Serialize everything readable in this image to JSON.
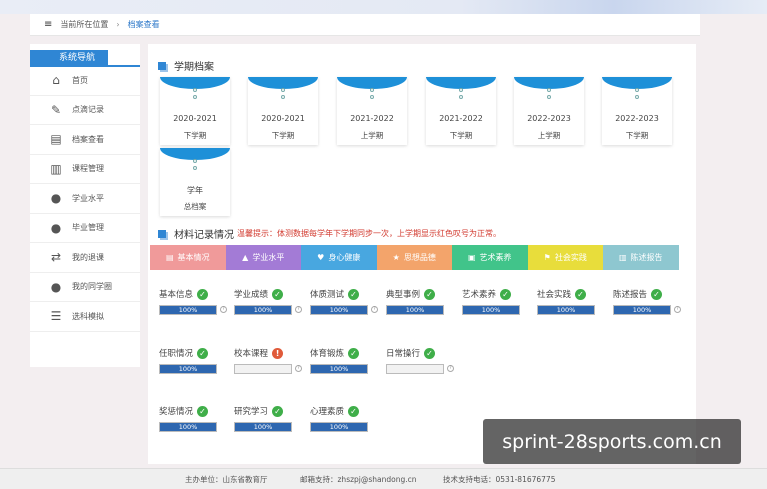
{
  "breadcrumb": {
    "prefix": "当前所在位置",
    "separator": "›",
    "current": "档案查看"
  },
  "sidebar": {
    "title": "系统导航",
    "items": [
      {
        "label": "首页",
        "icon": "home-icon"
      },
      {
        "label": "点滴记录",
        "icon": "edit-icon"
      },
      {
        "label": "档案查看",
        "icon": "archive-icon"
      },
      {
        "label": "课程管理",
        "icon": "book-icon"
      },
      {
        "label": "学业水平",
        "icon": "user-icon"
      },
      {
        "label": "毕业管理",
        "icon": "user-icon"
      },
      {
        "label": "我的退课",
        "icon": "transfer-icon"
      },
      {
        "label": "我的同学圈",
        "icon": "group-icon"
      },
      {
        "label": "选科模拟",
        "icon": "checklist-icon"
      }
    ]
  },
  "term_archive": {
    "title": "学期档案",
    "folders": [
      {
        "year": "2020-2021",
        "term": "下学期"
      },
      {
        "year": "2020-2021",
        "term": "下学期"
      },
      {
        "year": "2021-2022",
        "term": "上学期"
      },
      {
        "year": "2021-2022",
        "term": "下学期"
      },
      {
        "year": "2022-2023",
        "term": "上学期"
      },
      {
        "year": "2022-2023",
        "term": "下学期"
      },
      {
        "year": "学年",
        "term": "总档案"
      }
    ]
  },
  "material": {
    "title": "材料记录情况",
    "hint": "温馨提示：体测数据每学年下学期同步一次，上学期显示红色叹号为正常。",
    "tabs": [
      {
        "label": "基本情况",
        "color": "#f09a9a",
        "icon": "doc-icon"
      },
      {
        "label": "学业水平",
        "color": "#a37bd6",
        "icon": "grad-cap-icon"
      },
      {
        "label": "身心健康",
        "color": "#48a7e0",
        "icon": "heart-icon"
      },
      {
        "label": "思想品德",
        "color": "#f3a46b",
        "icon": "star-icon"
      },
      {
        "label": "艺术素养",
        "color": "#41c48a",
        "icon": "picture-icon"
      },
      {
        "label": "社会实践",
        "color": "#e8dd3b",
        "icon": "flag-icon"
      },
      {
        "label": "陈述报告",
        "color": "#8ec7d0",
        "icon": "report-icon"
      }
    ],
    "items": [
      {
        "name": "基本信息",
        "status": "ok",
        "progress": 100,
        "value": "100%"
      },
      {
        "name": "学业成绩",
        "status": "ok",
        "progress": 100,
        "value": "100%"
      },
      {
        "name": "体质测试",
        "status": "ok",
        "progress": 100,
        "value": "100%"
      },
      {
        "name": "典型事例",
        "status": "ok",
        "progress": 100,
        "value": "100%"
      },
      {
        "name": "艺术素养",
        "status": "ok",
        "progress": 100,
        "value": "100%"
      },
      {
        "name": "社会实践",
        "status": "ok",
        "progress": 100,
        "value": "100%"
      },
      {
        "name": "陈述报告",
        "status": "ok",
        "progress": 100,
        "value": "100%"
      },
      {
        "name": "任职情况",
        "status": "ok",
        "progress": 100,
        "value": "100%"
      },
      {
        "name": "校本课程",
        "status": "warn",
        "progress": 0,
        "value": ""
      },
      {
        "name": "体育锻炼",
        "status": "ok",
        "progress": 100,
        "value": "100%"
      },
      {
        "name": "日常操行",
        "status": "ok",
        "progress": 0,
        "value": ""
      },
      {
        "name": "奖惩情况",
        "status": "ok",
        "progress": 100,
        "value": "100%"
      },
      {
        "name": "研究学习",
        "status": "ok",
        "progress": 100,
        "value": "100%"
      },
      {
        "name": "心理素质",
        "status": "ok",
        "progress": 100,
        "value": "100%"
      }
    ]
  },
  "footer": {
    "host": "主办单位：山东省教育厅",
    "email": "邮箱支持：zhszpj@shandong.cn",
    "phone": "技术支持电话：0531-81676775"
  },
  "watermark": "sprint-28sports.com.cn",
  "colors": {
    "accent": "#2f86d4",
    "ok": "#3fae49",
    "warn": "#e05a3a",
    "bar": "#2e67b0"
  }
}
